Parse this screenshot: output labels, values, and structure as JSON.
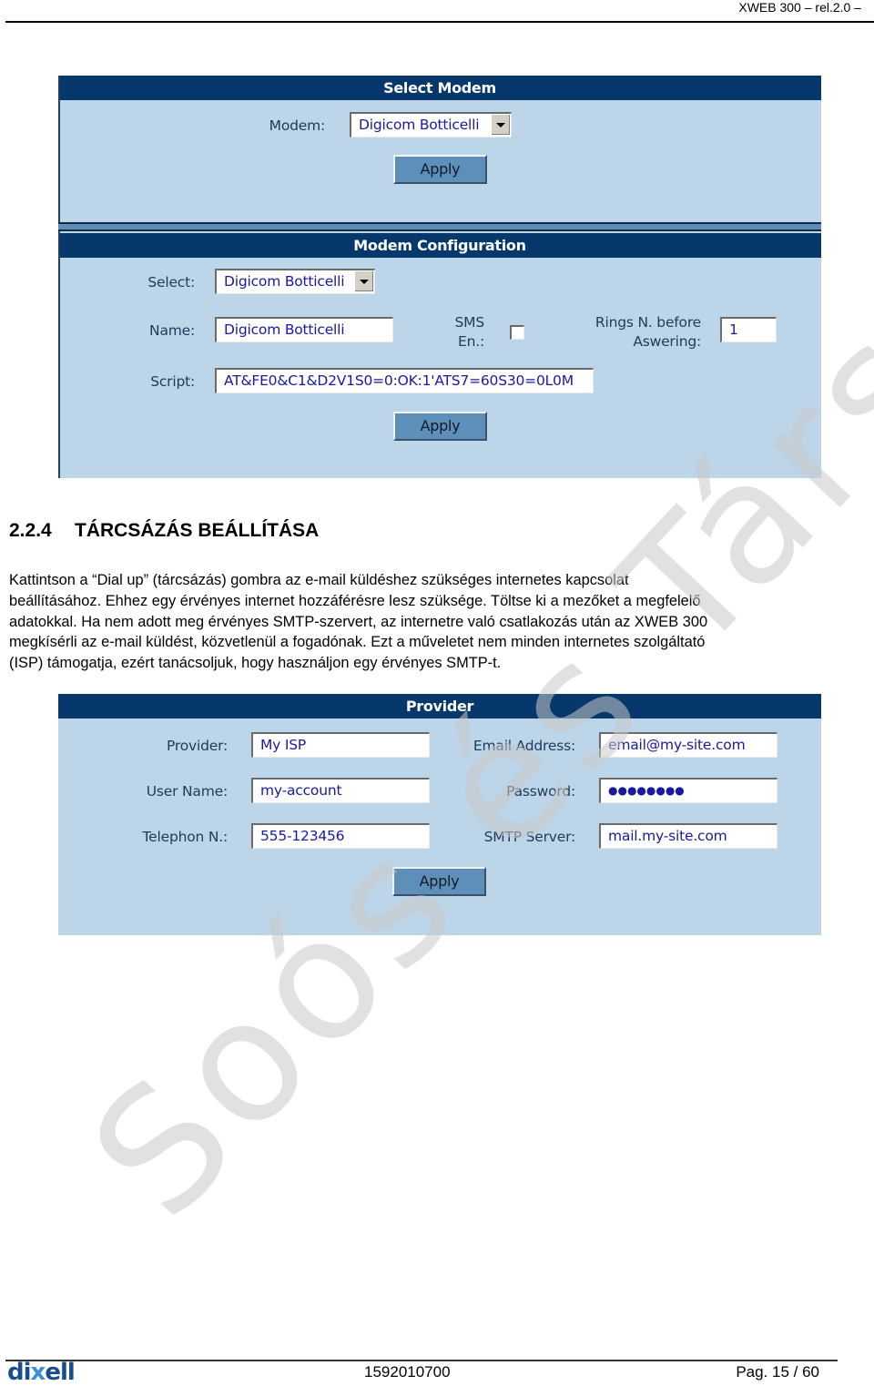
{
  "header": {
    "running_title": "XWEB 300 – rel.2.0 –"
  },
  "select_modem_panel": {
    "title": "Select Modem",
    "modem_label": "Modem:",
    "modem_value": "Digicom Botticelli",
    "apply_label": "Apply"
  },
  "modem_config_panel": {
    "title": "Modem Configuration",
    "select_label": "Select:",
    "select_value": "Digicom Botticelli",
    "name_label": "Name:",
    "name_value": "Digicom Botticelli",
    "sms_label_line1": "SMS",
    "sms_label_line2": "En.:",
    "sms_enabled": false,
    "rings_label_line1": "Rings N. before",
    "rings_label_line2": "Aswering:",
    "rings_value": "1",
    "script_label": "Script:",
    "script_value": "AT&FE0&C1&D2V1S0=0:OK:1'ATS7=60S30=0L0M",
    "apply_label": "Apply"
  },
  "section": {
    "number": "2.2.4",
    "title": "TÁRCSÁZÁS BEÁLLÍTÁSA",
    "paragraph_lines": [
      "Kattintson a  “Dial up” (tárcsázás) gombra az e-mail küldéshez szükséges internetes kapcsolat",
      "beállításához.  Ehhez egy érvényes internet hozzáférésre lesz szüksége. Töltse ki a mezőket a megfelelő",
      "adatokkal. Ha nem adott meg érvényes SMTP-szervert, az internetre való csatlakozás után az XWEB 300",
      "megkísérli az e-mail küldést, közvetlenül a fogadónak. Ezt a műveletet nem minden internetes szolgáltató",
      "(ISP) támogatja, ezért tanácsoljuk, hogy használjon egy érvényes SMTP-t."
    ]
  },
  "provider_panel": {
    "title": "Provider",
    "provider_label": "Provider:",
    "provider_value": "My ISP",
    "username_label": "User Name:",
    "username_value": "my-account",
    "telephone_label": "Telephon N.:",
    "telephone_value": "555-123456",
    "email_label": "Email Address:",
    "email_value": "email@my-site.com",
    "password_label": "Password:",
    "password_value": "●●●●●●●●",
    "smtp_label": "SMTP Server:",
    "smtp_value": "mail.my-site.com",
    "apply_label": "Apply"
  },
  "watermark": {
    "text": "Soós és Társa Z"
  },
  "footer": {
    "logo": {
      "part1": "di",
      "part2": "x",
      "part3": "ell"
    },
    "doc_number": "1592010700",
    "page": "Pag. 15 / 60"
  }
}
